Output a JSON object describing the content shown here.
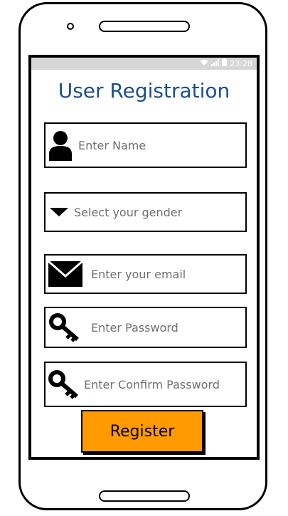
{
  "status_bar": {
    "time": "23:28",
    "icons": [
      "wifi-icon",
      "signal-icon",
      "battery-icon"
    ]
  },
  "title": "User Registration",
  "form": {
    "name": {
      "placeholder": "Enter Name",
      "icon": "user-icon"
    },
    "gender": {
      "placeholder": "Select your gender",
      "icon": "dropdown-arrow-icon"
    },
    "email": {
      "placeholder": "Enter your email",
      "icon": "envelope-icon"
    },
    "password": {
      "placeholder": "Enter Password",
      "icon": "key-icon"
    },
    "confirm_password": {
      "placeholder": "Enter Confirm Password",
      "icon": "key-icon"
    }
  },
  "register_button": {
    "label": "Register",
    "color": "#ff9a00"
  },
  "colors": {
    "title": "#1b4f8d",
    "status_bar": "#d6d6d6",
    "placeholder": "#6f6f6f"
  }
}
